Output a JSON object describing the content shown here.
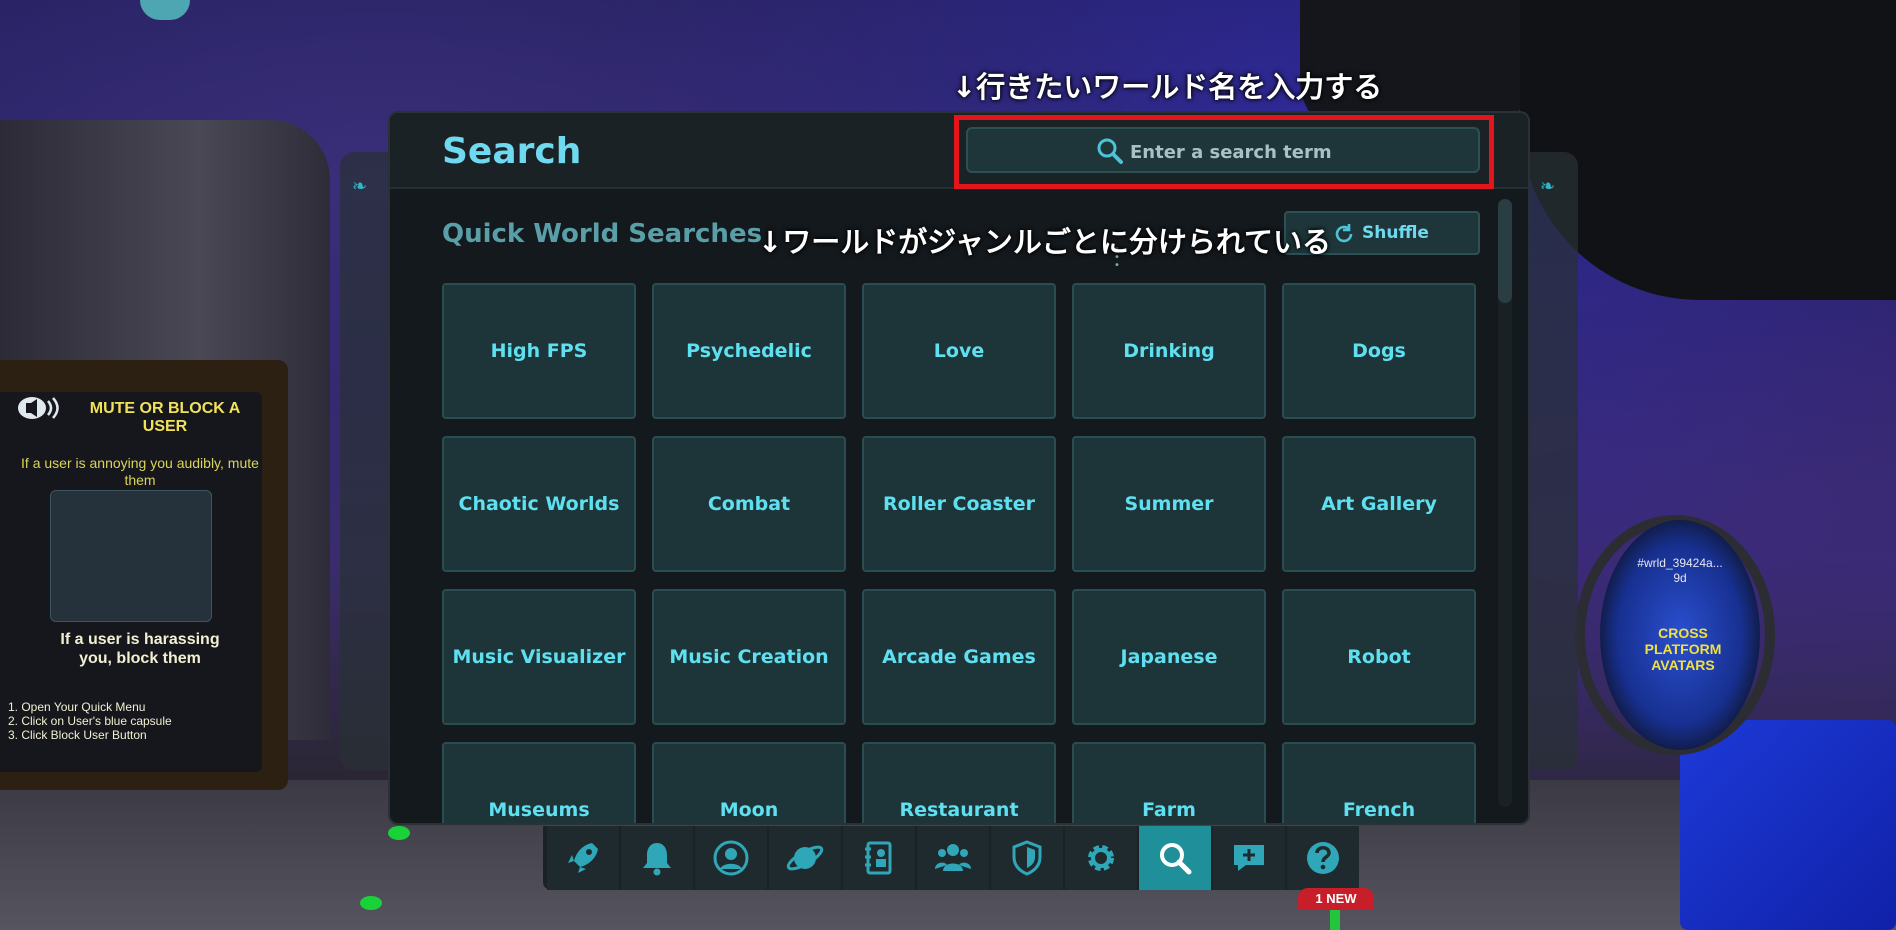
{
  "annotations": {
    "top": "↓行きたいワールド名を入力する",
    "mid": "↓ワールドがジャンルごとに分けられている"
  },
  "search_panel": {
    "title": "Search",
    "search_placeholder": "Enter a search term",
    "section_title": "Quick World Searches",
    "shuffle_label": "Shuffle"
  },
  "categories": [
    "High FPS",
    "Psychedelic",
    "Love",
    "Drinking",
    "Dogs",
    "Chaotic Worlds",
    "Combat",
    "Roller Coaster",
    "Summer",
    "Art Gallery",
    "Music Visualizer",
    "Music Creation",
    "Arcade Games",
    "Japanese",
    "Robot",
    "Museums",
    "Moon",
    "Restaurant",
    "Farm",
    "French"
  ],
  "dock": {
    "items": [
      {
        "name": "rocket-icon",
        "active": false
      },
      {
        "name": "bell-icon",
        "active": false
      },
      {
        "name": "profile-icon",
        "active": false
      },
      {
        "name": "planet-icon",
        "active": false
      },
      {
        "name": "contacts-book-icon",
        "active": false
      },
      {
        "name": "group-icon",
        "active": false
      },
      {
        "name": "shield-icon",
        "active": false
      },
      {
        "name": "gear-icon",
        "active": false
      },
      {
        "name": "search-icon",
        "active": true
      },
      {
        "name": "chat-add-icon",
        "active": false
      },
      {
        "name": "help-icon",
        "active": false
      }
    ],
    "new_badge": "1 NEW"
  },
  "signboard": {
    "title": "MUTE OR BLOCK A USER",
    "text1": "If a user is annoying you audibly, mute them",
    "text2": "If a user is harassing you, block them",
    "steps": [
      "1. Open Your Quick Menu",
      "2. Click on User's blue capsule",
      "3. Click Block User Button"
    ]
  },
  "portal": {
    "world_id": "#wrld_39424a...",
    "age": "9d",
    "label": "CROSS PLATFORM AVATARS"
  },
  "colors": {
    "accent": "#6fd9ef",
    "tile_bg": "#1d3538",
    "active_dock": "#1f8f9a",
    "highlight": "#e3141c"
  }
}
